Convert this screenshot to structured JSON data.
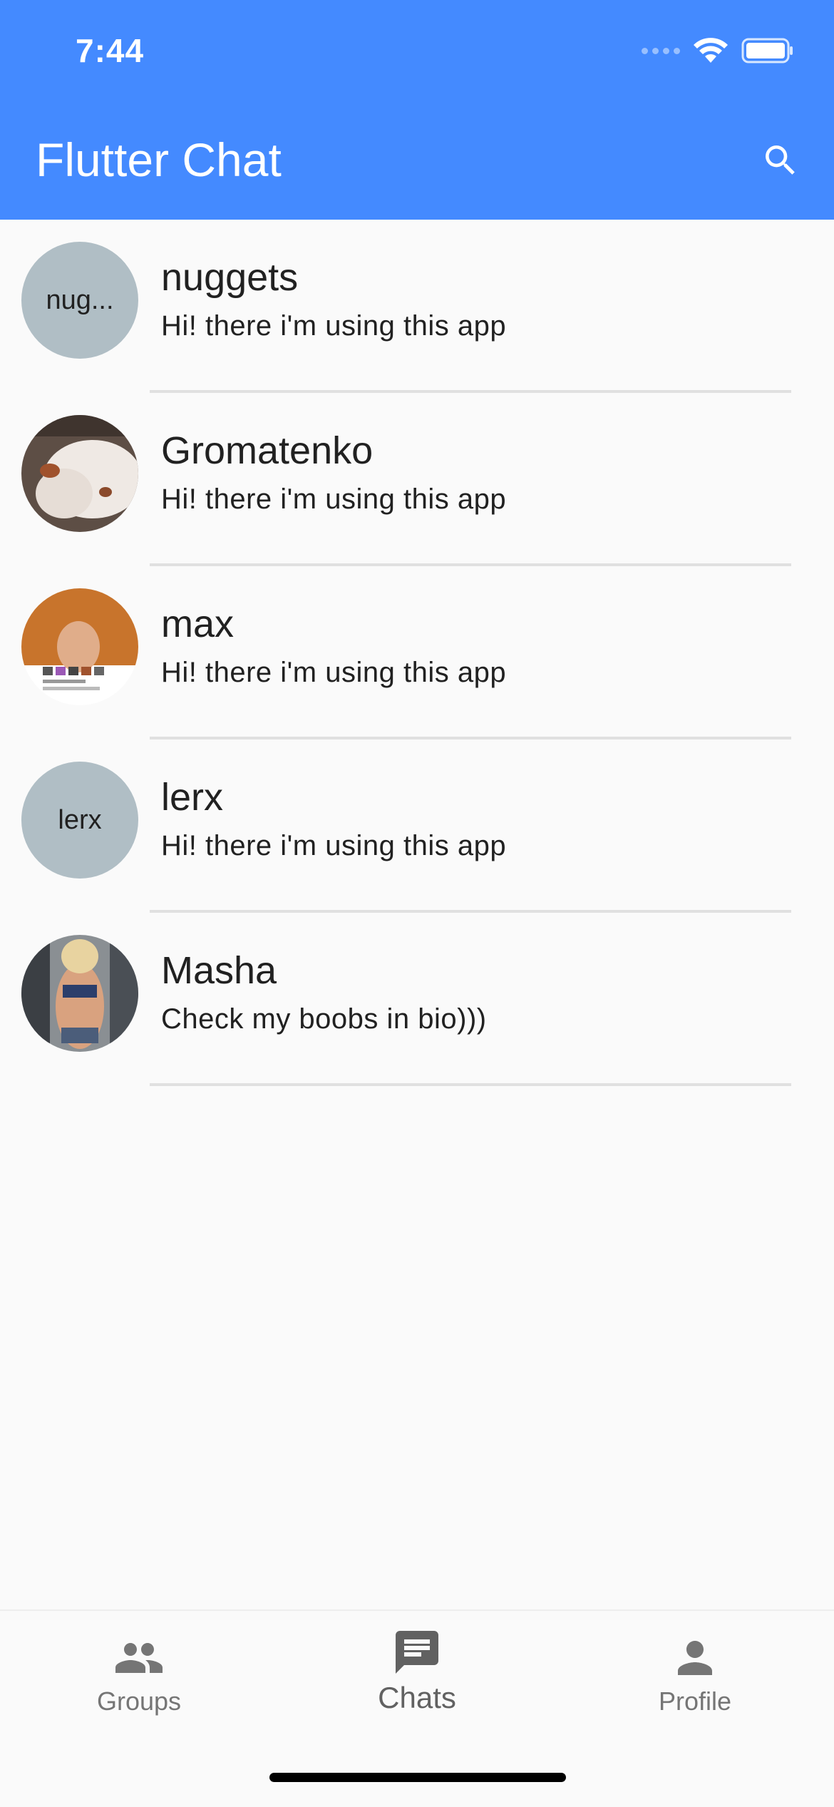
{
  "status_bar": {
    "time": "7:44"
  },
  "app_bar": {
    "title": "Flutter Chat",
    "search_icon": "search-icon"
  },
  "chats": [
    {
      "name": "nuggets",
      "message": "Hi! there i'm using this app",
      "avatar_text": "nug..."
    },
    {
      "name": "Gromatenko",
      "message": "Hi! there i'm using this app",
      "avatar_text": ""
    },
    {
      "name": "max",
      "message": "Hi! there i'm using this app",
      "avatar_text": ""
    },
    {
      "name": "lerx",
      "message": "Hi! there i'm using this app",
      "avatar_text": "lerx"
    },
    {
      "name": "Masha",
      "message": "Check my boobs in bio)))",
      "avatar_text": ""
    }
  ],
  "bottom_nav": {
    "items": [
      {
        "label": "Groups",
        "icon": "groups-icon"
      },
      {
        "label": "Chats",
        "icon": "chat-icon"
      },
      {
        "label": "Profile",
        "icon": "person-icon"
      }
    ],
    "active": "Chats"
  },
  "colors": {
    "app_bar": "#448aff",
    "avatar_placeholder": "#b0bec5",
    "background": "#fafafa"
  }
}
